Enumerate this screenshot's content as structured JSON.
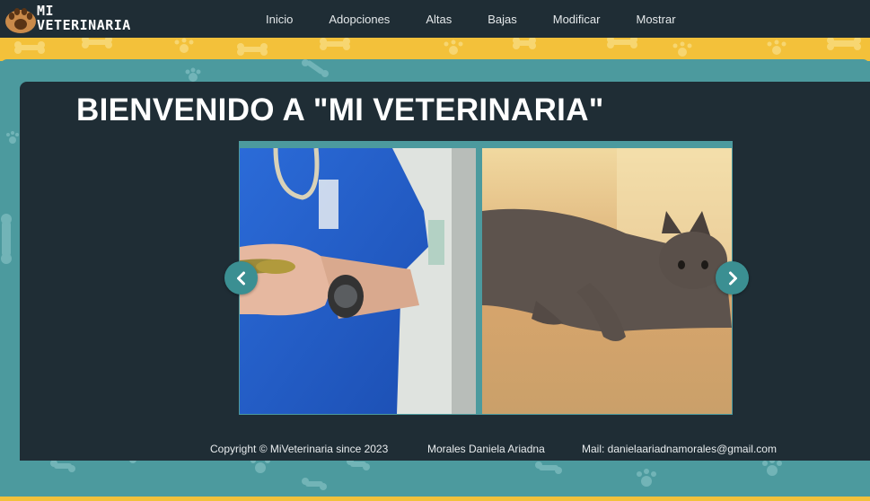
{
  "navbar": {
    "logo": {
      "line1": "MI",
      "line2": "VETERINARIA",
      "icon": "paw-icon"
    },
    "links": [
      "Inicio",
      "Adopciones",
      "Altas",
      "Bajas",
      "Modificar",
      "Mostrar"
    ]
  },
  "main": {
    "title": "BIENVENIDO A \"MI VETERINARIA\""
  },
  "carousel": {
    "prev_icon": "chevron-left-icon",
    "next_icon": "chevron-right-icon",
    "slides": [
      {
        "icon": "vet-holding-lizard-photo"
      },
      {
        "icon": "gray-cat-lying-photo"
      }
    ]
  },
  "footer": {
    "copyright": "Copyright © MiVeterinaria since 2023",
    "author": "Morales Daniela Ariadna",
    "mail": "Mail: danielaariadnamorales@gmail.com"
  },
  "colors": {
    "navbar": "#1f2d35",
    "band": "#f3c13a",
    "frame": "#4c9a9e",
    "panel": "#1f2d35",
    "accent": "#3b8f92"
  }
}
